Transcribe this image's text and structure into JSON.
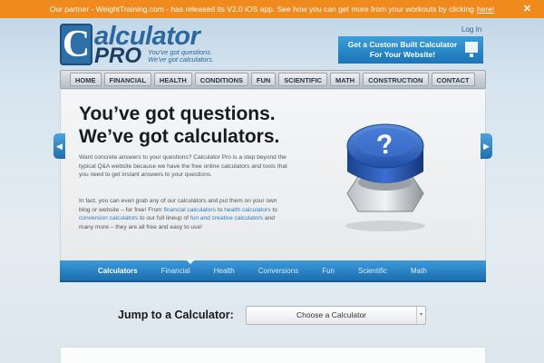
{
  "promo": {
    "text": "Our partner - WeightTraining.com - has released its V2.0 iOS app. See how you can get more from your workouts by clicking",
    "link": "here!",
    "close": "✕"
  },
  "header": {
    "logo_c": "C",
    "logo_word": "alculator",
    "logo_pro": "PRO",
    "logo_tag_line1": "You've got questions.",
    "logo_tag_line2": "We've got calculators.",
    "login": "Log In",
    "ad_line1": "Get a Custom Built Calculator",
    "ad_line2": "For Your Website!"
  },
  "nav": [
    "HOME",
    "FINANCIAL",
    "HEALTH",
    "CONDITIONS",
    "FUN",
    "SCIENTIFIC",
    "MATH",
    "CONSTRUCTION",
    "CONTACT"
  ],
  "hero": {
    "title_line1": "You’ve got questions.",
    "title_line2": "We’ve got calculators.",
    "para1": "Want concrete answers to your questions? Calculator Pro is a step beyond the typical Q&A website because we have the free online calculators and tools that you need to get instant answers to your questions.",
    "para2_a": "In fact, you can even grab any of our calculators and put them on your own blog or website – for free! From",
    "link_financial": "financial calculators",
    "para2_b": "to",
    "link_health": "health calculators",
    "para2_c": "to",
    "link_conversion": "conversion calculators",
    "para2_d": "to our full lineup of",
    "link_fun": "fun and creative calculators",
    "para2_e": "and many more – they are all free and easy to use!",
    "button_symbol": "?",
    "arrow_left": "◀",
    "arrow_right": "▶"
  },
  "tabs": [
    "Calculators",
    "Financial",
    "Health",
    "Conversions",
    "Fun",
    "Scientific",
    "Math"
  ],
  "jump": {
    "label": "Jump to a Calculator:",
    "select_value": "Choose a Calculator",
    "select_arrow": "▾"
  },
  "colors": {
    "promo": "#f08a1c",
    "accent": "#2b7cc4",
    "tab_bar": "#1f6fb0",
    "button_blue": "#2f66c4"
  }
}
